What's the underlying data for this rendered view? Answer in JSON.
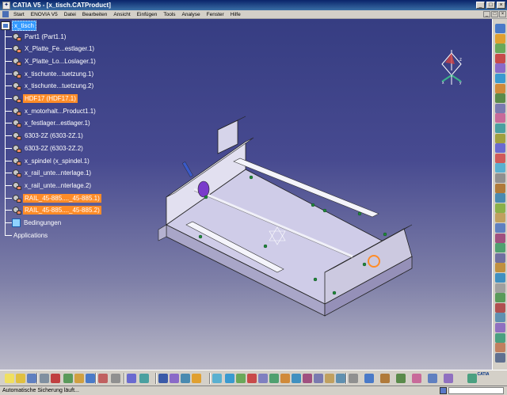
{
  "window": {
    "title": "CATIA V5 - [x_tisch.CATProduct]",
    "controls": [
      "_",
      "□",
      "×"
    ]
  },
  "menubar": {
    "items": [
      "Start",
      "ENOVIA V5",
      "Datei",
      "Bearbeiten",
      "Ansicht",
      "Einfügen",
      "Tools",
      "Analyse",
      "Fenster",
      "Hilfe"
    ],
    "doc_controls": [
      "_",
      "□",
      "×"
    ]
  },
  "tree": {
    "root": "x_tisch",
    "items": [
      {
        "label": "Part1 (Part1.1)",
        "highlight": false
      },
      {
        "label": "X_Platte_Fe...estlager.1)",
        "highlight": false
      },
      {
        "label": "X_Platte_Lo...Loslager.1)",
        "highlight": false
      },
      {
        "label": "x_tischunte...tuetzung.1)",
        "highlight": false
      },
      {
        "label": "x_tischunte...tuetzung.2)",
        "highlight": false
      },
      {
        "label": "HDF17 (HDF17.1)",
        "highlight": true
      },
      {
        "label": "x_motorhalt...Product1.1)",
        "highlight": false
      },
      {
        "label": "x_festlager...estlager.1)",
        "highlight": false
      },
      {
        "label": "6303-2Z (6303-2Z.1)",
        "highlight": false
      },
      {
        "label": "6303-2Z (6303-2Z.2)",
        "highlight": false
      },
      {
        "label": "x_spindel (x_spindel.1)",
        "highlight": false
      },
      {
        "label": "x_rail_unte...nterlage.1)",
        "highlight": false
      },
      {
        "label": "x_rail_unte...nterlage.2)",
        "highlight": false
      },
      {
        "label": "RAIL_45-885...._45-885.1)",
        "highlight": true
      },
      {
        "label": "RAIL_45-885...._45-885.2)",
        "highlight": true
      }
    ],
    "constraints": "Bedingungen",
    "applications": "Applications"
  },
  "status": {
    "text": "Automatische Sicherung läuft..."
  },
  "branding": {
    "logo": "CATIA"
  },
  "colors": {
    "highlight": "#ff8c28",
    "selection": "#3399ff",
    "viewport_top": "#363d82",
    "viewport_bottom": "#b9b8c7"
  }
}
